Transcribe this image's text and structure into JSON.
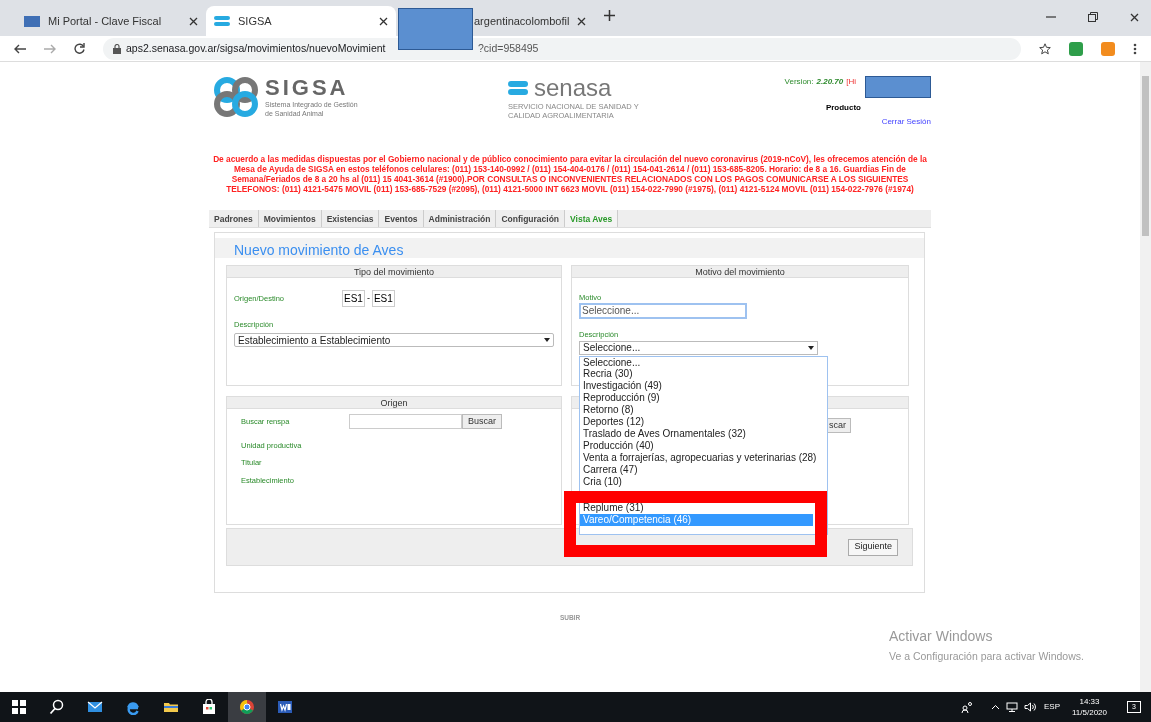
{
  "browser": {
    "tabs": [
      {
        "title": "Mi Portal - Clave Fiscal",
        "selected": false
      },
      {
        "title": "SIGSA",
        "selected": true
      },
      {
        "title": "argentinacolombofil",
        "selected": false
      }
    ],
    "url_start": "aps2.senasa.gov.ar/sigsa/movimientos/nuevoMovimient",
    "url_end": "?cid=958495"
  },
  "header": {
    "logo_name": "SIGSA",
    "logo_subtitle": "Sistema Integrado de Gestión de Sanidad Animal",
    "partner_name": "senasa",
    "partner_subtitle": "SERVICIO NACIONAL DE SANIDAD Y CALIDAD AGROALIMENTARIA",
    "version_label": "Version:",
    "version": "2.20.70",
    "history_link": "[Hi",
    "user_role": "Producto",
    "logout": "Cerrar Sesión"
  },
  "notice": "De acuerdo a las medidas dispuestas por el Gobierno nacional y de público conocimiento para evitar la circulación del nuevo coronavirus (2019-nCoV), les ofrecemos atención de la Mesa de Ayuda de SIGSA en estos teléfonos celulares: (011) 153-140-0992 / (011) 154-404-0176 / (011) 154-041-2614 / (011) 153-685-8205. Horario: de 8 a 16. Guardias Fin de Semana/Feriados de 8 a 20 hs al (011) 15 4041-3614 (#1900).POR CONSULTAS O INCONVENIENTES RELACIONADOS CON LOS PAGOS COMUNICARSE A LOS SIGUIENTES TELEFONOS: (011) 4121-5475 MOVIL (011) 153-685-7529 (#2095), (011) 4121-5000 INT 6623 MOVIL (011) 154-022-7990 (#1975), (011) 4121-5124 MOVIL (011) 154-022-7976 (#1974)",
  "nav": [
    {
      "label": "Padrones",
      "selected": false
    },
    {
      "label": "Movimientos",
      "selected": false
    },
    {
      "label": "Existencias",
      "selected": false
    },
    {
      "label": "Eventos",
      "selected": false
    },
    {
      "label": "Administración",
      "selected": false
    },
    {
      "label": "Configuración",
      "selected": false
    },
    {
      "label": "Vista Aves",
      "selected": true
    }
  ],
  "form": {
    "title": "Nuevo movimiento de Aves",
    "tipo": {
      "heading": "Tipo del movimiento",
      "origin_label": "Origen/Destino",
      "origin_code": "ES1",
      "separator": "-",
      "dest_code": "ES1",
      "description_label": "Descripción",
      "description_value": "Establecimiento a Establecimiento"
    },
    "motivo": {
      "heading": "Motivo del movimiento",
      "motivo_label": "Motivo",
      "motivo_value": "Seleccione...",
      "description_label": "Descripción",
      "description_value": "Seleccione..."
    },
    "origen": {
      "heading": "Origen",
      "search_label": "Buscar renspa",
      "search_button": "Buscar",
      "fields": [
        "Unidad productiva",
        "Titular",
        "Establecimiento"
      ]
    },
    "destino": {
      "search_button": "scar"
    },
    "next_button": "Siguiente",
    "dropdown_options": [
      {
        "label": "Seleccione...",
        "selected": false
      },
      {
        "label": "Recria (30)",
        "selected": false
      },
      {
        "label": "Investigación (49)",
        "selected": false
      },
      {
        "label": "Reproducción (9)",
        "selected": false
      },
      {
        "label": "Retorno (8)",
        "selected": false
      },
      {
        "label": "Deportes (12)",
        "selected": false
      },
      {
        "label": "Traslado de Aves Ornamentales (32)",
        "selected": false
      },
      {
        "label": "Producción (40)",
        "selected": false
      },
      {
        "label": "Venta a forrajerías, agropecuarias y veterinarias (28)",
        "selected": false
      },
      {
        "label": "Carrera (47)",
        "selected": false
      },
      {
        "label": "Cria (10)",
        "selected": false
      },
      {
        "label": "Replume (31)",
        "selected": false
      },
      {
        "label": "Vareo/Competencia (46)",
        "selected": true
      }
    ]
  },
  "footer_link": "SUBIR",
  "activation": {
    "title": "Activar Windows",
    "subtitle": "Ve a Configuración para activar Windows."
  },
  "taskbar": {
    "language": "ESP",
    "time": "14:33",
    "date": "11/5/2020",
    "notifications": "3"
  }
}
